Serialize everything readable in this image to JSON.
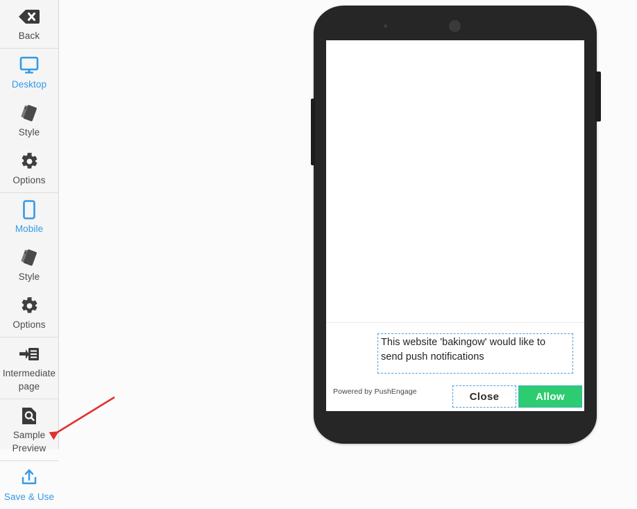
{
  "sidebar": {
    "groups": [
      {
        "items": [
          {
            "label": "Back",
            "icon": "backspace-x-icon",
            "active": false,
            "name": "sidebar-item-back"
          }
        ]
      },
      {
        "items": [
          {
            "label": "Desktop",
            "icon": "monitor-icon",
            "active": true,
            "name": "sidebar-item-desktop"
          },
          {
            "label": "Style",
            "icon": "style-cards-icon",
            "active": false,
            "name": "sidebar-item-desktop-style"
          },
          {
            "label": "Options",
            "icon": "gear-icon",
            "active": false,
            "name": "sidebar-item-desktop-options"
          }
        ]
      },
      {
        "items": [
          {
            "label": "Mobile",
            "icon": "phone-icon",
            "active": true,
            "name": "sidebar-item-mobile"
          },
          {
            "label": "Style",
            "icon": "style-cards-icon",
            "active": false,
            "name": "sidebar-item-mobile-style"
          },
          {
            "label": "Options",
            "icon": "gear-icon",
            "active": false,
            "name": "sidebar-item-mobile-options"
          }
        ]
      },
      {
        "items": [
          {
            "label": "Intermediate page",
            "icon": "arrow-into-list-icon",
            "active": false,
            "name": "sidebar-item-intermediate-page"
          }
        ]
      },
      {
        "items": [
          {
            "label": "Sample Preview",
            "icon": "document-magnifier-icon",
            "active": false,
            "name": "sidebar-item-sample-preview"
          }
        ]
      },
      {
        "items": [
          {
            "label": "Save & Use",
            "icon": "upload-icon",
            "active": true,
            "name": "sidebar-item-save-and-use"
          }
        ]
      }
    ]
  },
  "preview": {
    "device": "mobile-phone-frame",
    "optin": {
      "message": "This website 'bakingow' would like to send push notifications",
      "powered_by": "Powered by PushEngage",
      "close_label": "Close",
      "allow_label": "Allow"
    }
  },
  "colors": {
    "accent_blue": "#3399e6",
    "allow_green": "#2ecc71",
    "dashed_outline": "#4a9fe0",
    "arrow_red": "#e03131",
    "phone_body": "#262626",
    "sidebar_bg": "#f5f5f5"
  },
  "annotation": {
    "arrow": "red-arrow-pointing-to-save-and-use"
  }
}
